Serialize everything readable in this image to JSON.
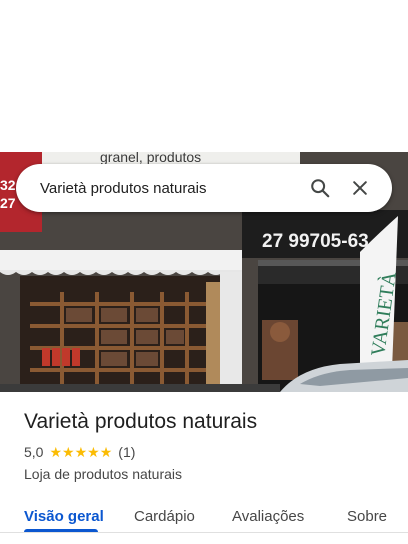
{
  "search": {
    "query": "Varietà produtos naturais"
  },
  "photo": {
    "sign_top_text": "granel, produtos",
    "phone_text": "27 99705-63",
    "flag_text": "VARIETÀ",
    "left_sign_text": "32\n27"
  },
  "place": {
    "name": "Varietà produtos naturais",
    "rating": "5,0",
    "stars": 5,
    "review_count": "(1)",
    "category": "Loja de produtos naturais"
  },
  "tabs": [
    {
      "label": "Visão geral",
      "active": true
    },
    {
      "label": "Cardápio",
      "active": false
    },
    {
      "label": "Avaliações",
      "active": false
    },
    {
      "label": "Sobre",
      "active": false
    }
  ],
  "colors": {
    "accent": "#0b57d0",
    "star": "#fbbc04"
  }
}
